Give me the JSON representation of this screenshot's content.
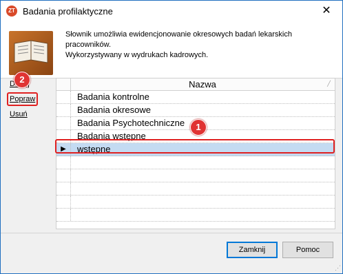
{
  "window": {
    "title": "Badania profilaktyczne",
    "app_icon_text": "ZT",
    "close_glyph": "✕"
  },
  "header": {
    "description_line1": "Słownik umożliwia ewidencjonowanie okresowych badań lekarskich pracowników.",
    "description_line2": "Wykorzystywany w wydrukach kadrowych."
  },
  "actions": {
    "add_label": "Dodaj",
    "edit_label": "Popraw",
    "delete_label": "Usuń"
  },
  "grid": {
    "column_header": "Nazwa",
    "rows": [
      {
        "name": "Badania kontrolne"
      },
      {
        "name": "Badania okresowe"
      },
      {
        "name": "Badania Psychotechniczne"
      },
      {
        "name": "Badania wstępne"
      },
      {
        "name": "wstępne",
        "selected": true
      }
    ],
    "row_pointer_glyph": "▶"
  },
  "annotations": {
    "marker_1": "1",
    "marker_2": "2",
    "marker_color": "#e03333"
  },
  "buttons": {
    "close_label": "Zamknij",
    "help_label": "Pomoc"
  }
}
